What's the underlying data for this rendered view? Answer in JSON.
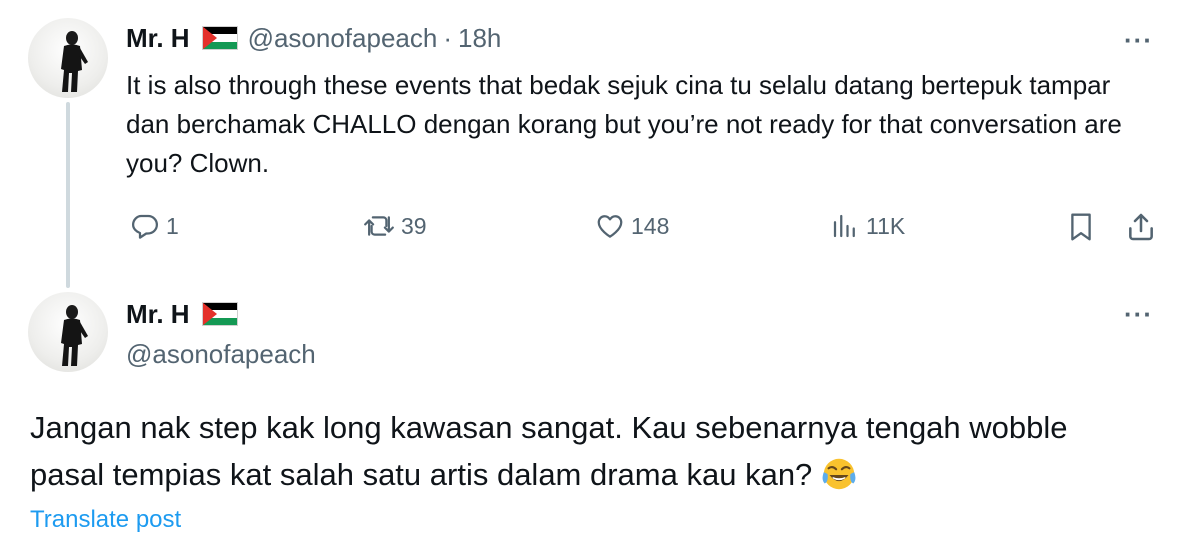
{
  "tweet1": {
    "author_name": "Mr. H",
    "author_handle": "@asonofapeach",
    "separator": "·",
    "time": "18h",
    "text": "It is also through these events that bedak sejuk cina tu selalu datang bertepuk tampar dan berchamak CHALLO dengan korang but you’re not ready for that conversation are you? Clown.",
    "more_label": "···",
    "stats": {
      "replies": "1",
      "reposts": "39",
      "likes": "148",
      "views": "11K"
    },
    "icons": [
      "reply-icon",
      "repost-icon",
      "like-icon",
      "views-icon",
      "bookmark-icon",
      "share-icon"
    ]
  },
  "tweet2": {
    "author_name": "Mr. H",
    "author_handle": "@asonofapeach",
    "text": "Jangan nak step kak long kawasan sangat. Kau sebenarnya tengah wobble pasal tempias kat salah satu artis dalam drama kau kan?",
    "emoji": "face-with-tears-of-joy",
    "more_label": "···",
    "translate_label": "Translate post"
  },
  "colors": {
    "text_primary": "#0f1419",
    "text_secondary": "#536471",
    "link": "#1d9bf0",
    "thread_line": "#cfd9de"
  }
}
